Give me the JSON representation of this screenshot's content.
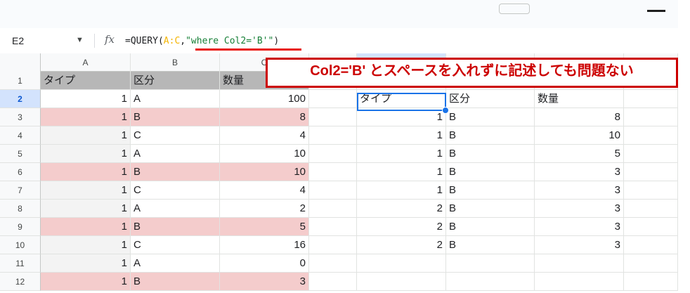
{
  "top_toolbar": {
    "button_icon": "toolbar-button",
    "menu_icon": "menu-line-icon"
  },
  "formula_bar": {
    "name_box": "E2",
    "dropdown_icon": "▼",
    "fx_icon": "fx",
    "formula_parts": [
      "=QUERY(",
      "A:C",
      ",",
      "\"where Col2='B'\"",
      ")"
    ]
  },
  "columns": [
    "A",
    "B",
    "C",
    "",
    "",
    "",
    "",
    ""
  ],
  "selected_column_index": 4,
  "selected_row": "2",
  "rows": [
    {
      "row": "1",
      "a": "タイプ",
      "b": "区分",
      "c": "数量",
      "e": "",
      "f": "",
      "g": ""
    },
    {
      "row": "2",
      "a": "1",
      "b": "A",
      "c": "100",
      "e": "タイプ",
      "f": "区分",
      "g": "数量"
    },
    {
      "row": "3",
      "a": "1",
      "b": "B",
      "c": "8",
      "e": "1",
      "f": "B",
      "g": "8"
    },
    {
      "row": "4",
      "a": "1",
      "b": "C",
      "c": "4",
      "e": "1",
      "f": "B",
      "g": "10"
    },
    {
      "row": "5",
      "a": "1",
      "b": "A",
      "c": "10",
      "e": "1",
      "f": "B",
      "g": "5"
    },
    {
      "row": "6",
      "a": "1",
      "b": "B",
      "c": "10",
      "e": "1",
      "f": "B",
      "g": "3"
    },
    {
      "row": "7",
      "a": "1",
      "b": "C",
      "c": "4",
      "e": "1",
      "f": "B",
      "g": "3"
    },
    {
      "row": "8",
      "a": "1",
      "b": "A",
      "c": "2",
      "e": "2",
      "f": "B",
      "g": "3"
    },
    {
      "row": "9",
      "a": "1",
      "b": "B",
      "c": "5",
      "e": "2",
      "f": "B",
      "g": "3"
    },
    {
      "row": "10",
      "a": "1",
      "b": "C",
      "c": "16",
      "e": "2",
      "f": "B",
      "g": "3"
    },
    {
      "row": "11",
      "a": "1",
      "b": "A",
      "c": "0",
      "e": "",
      "f": "",
      "g": ""
    },
    {
      "row": "12",
      "a": "1",
      "b": "B",
      "c": "3",
      "e": "",
      "f": "",
      "g": ""
    }
  ],
  "annotation": {
    "text": "Col2='B' とスペースを入れずに記述しても問題ない"
  },
  "colors": {
    "header_fill": "#b7b7b7",
    "highlight_pink": "#f4cccc",
    "stripe_gray": "#f3f3f3",
    "selection_blue": "#1a73e8",
    "annotation_red": "#cc0000",
    "formula_range": "#f4b400",
    "formula_string": "#188038"
  }
}
